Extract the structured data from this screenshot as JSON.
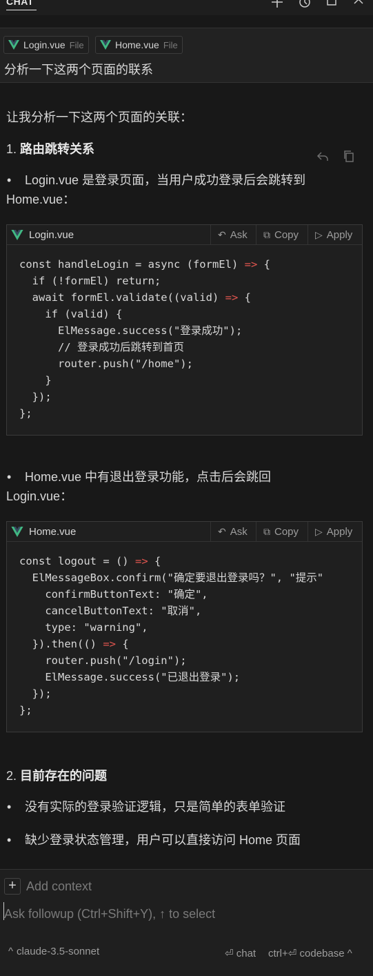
{
  "header": {
    "title": "CHAT",
    "icons": [
      "plus-icon",
      "history-icon",
      "maximize-icon",
      "close-icon"
    ]
  },
  "user_message": {
    "chips": [
      {
        "name": "Login.vue",
        "kind": "File"
      },
      {
        "name": "Home.vue",
        "kind": "File"
      }
    ],
    "text": "分析一下这两个页面的联系"
  },
  "response": {
    "intro": "让我分析一下这两个页面的关联：",
    "section1": {
      "number": "1.",
      "title": "路由跳转关系"
    },
    "bullet1": {
      "line1": "Login.vue 是登录页面，当用户成功登录后会跳转到",
      "line2": "Home.vue："
    },
    "code1": {
      "file": "Login.vue",
      "lines": [
        "const handleLogin = async (formEl) => {",
        "  if (!formEl) return;",
        "  await formEl.validate((valid) => {",
        "    if (valid) {",
        "      ElMessage.success(\"登录成功\");",
        "      // 登录成功后跳转到首页",
        "      router.push(\"/home\");",
        "    }",
        "  });",
        "};"
      ]
    },
    "bullet2": {
      "line1": "Home.vue 中有退出登录功能，点击后会跳回",
      "line2": "Login.vue："
    },
    "code2": {
      "file": "Home.vue",
      "lines": [
        "const logout = () => {",
        "  ElMessageBox.confirm(\"确定要退出登录吗？\", \"提示\"",
        "    confirmButtonText: \"确定\",",
        "    cancelButtonText: \"取消\",",
        "    type: \"warning\",",
        "  }).then(() => {",
        "    router.push(\"/login\");",
        "    ElMessage.success(\"已退出登录\");",
        "  });",
        "};"
      ]
    },
    "section2": {
      "number": "2.",
      "title": "目前存在的问题"
    },
    "bullet3": "没有实际的登录验证逻辑，只是简单的表单验证",
    "bullet4": "缺少登录状态管理，用户可以直接访问 Home 页面"
  },
  "code_actions": {
    "ask": "Ask",
    "copy": "Copy",
    "apply": "Apply"
  },
  "input": {
    "add_context": "Add context",
    "placeholder": "Ask followup (Ctrl+Shift+Y), ↑ to select"
  },
  "footer": {
    "model": "claude-3.5-sonnet",
    "chat_label": "chat",
    "codebase_prefix": "ctrl+",
    "codebase_label": "codebase"
  }
}
